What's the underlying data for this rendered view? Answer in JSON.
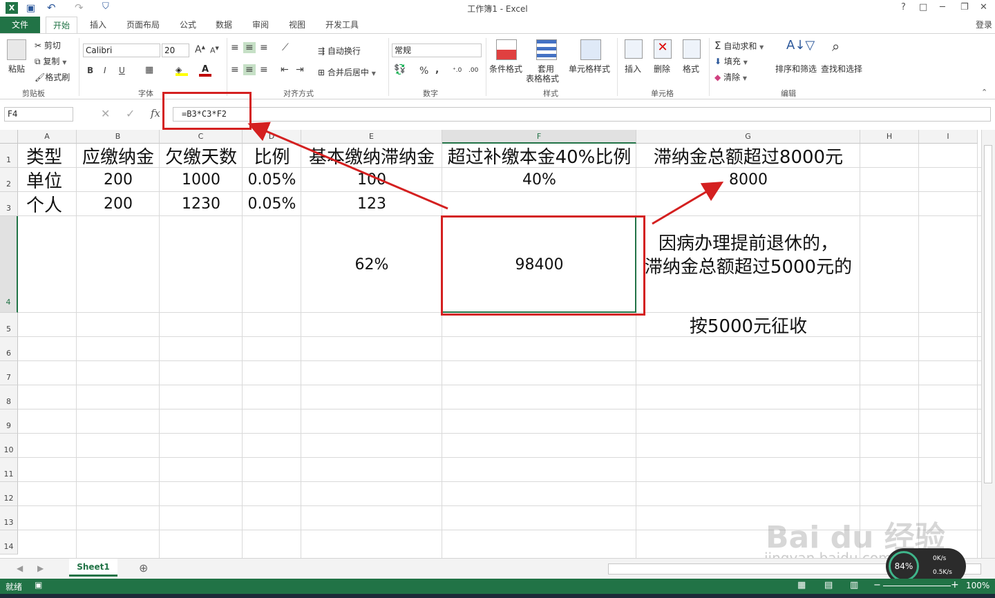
{
  "window": {
    "title": "工作簿1 - Excel",
    "controls": [
      "?",
      "□",
      "─",
      "❐",
      "✕"
    ],
    "signin": "登录"
  },
  "ribbon_tabs": [
    "文件",
    "开始",
    "插入",
    "页面布局",
    "公式",
    "数据",
    "审阅",
    "视图",
    "开发工具"
  ],
  "clipboard": {
    "paste": "粘贴",
    "cut": "剪切",
    "copy": "复制",
    "format_painter": "格式刷",
    "group": "剪贴板"
  },
  "font": {
    "name": "Calibri",
    "size": "20",
    "group": "字体",
    "bold": "B",
    "italic": "I",
    "underline": "U"
  },
  "alignment": {
    "wrap": "自动换行",
    "merge": "合并后居中",
    "group": "对齐方式"
  },
  "number": {
    "format": "常规",
    "percent": "%",
    "comma": ",",
    "group": "数字"
  },
  "styles": {
    "conditional": "条件格式",
    "table1": "套用",
    "table2": "表格格式",
    "cell_styles": "单元格样式",
    "group": "样式"
  },
  "cells": {
    "insert": "插入",
    "delete": "删除",
    "format": "格式",
    "group": "单元格"
  },
  "editing": {
    "autosum": "自动求和",
    "fill": "填充",
    "clear": "清除",
    "sort": "排序和筛选",
    "find": "查找和选择",
    "group": "编辑"
  },
  "formula_bar": {
    "name_box": "F4",
    "formula": "=B3*C3*F2",
    "fx": "fx"
  },
  "columns": [
    "A",
    "B",
    "C",
    "D",
    "E",
    "F",
    "G",
    "H",
    "I"
  ],
  "rows": [
    "1",
    "2",
    "3",
    "4",
    "5",
    "6",
    "7",
    "8",
    "9",
    "10",
    "11",
    "12",
    "13",
    "14"
  ],
  "cells_data": {
    "A1": "类型",
    "B1": "应缴纳金",
    "C1": "欠缴天数",
    "D1": "比例",
    "E1": "基本缴纳滞纳金",
    "F1": "超过补缴本金40%比例",
    "G1": "滞纳金总额超过8000元",
    "A2": "单位",
    "B2": "200",
    "C2": "1000",
    "D2": "0.05%",
    "E2": "100",
    "F2": "40%",
    "G2": "8000",
    "A3": "个人",
    "B3": "200",
    "C3": "1230",
    "D3": "0.05%",
    "E3": "123",
    "E4": "62%",
    "F4": "98400",
    "G4a": "因病办理提前退休的，",
    "G4b": "滞纳金总额超过5000元的",
    "G5": "按5000元征收"
  },
  "sheet": {
    "tab": "Sheet1",
    "add": "⊕"
  },
  "status": {
    "ready": "就绪",
    "zoom": "100%"
  },
  "watermark": {
    "text1": "Bai du 经验",
    "text2": "jingyan.baidu.com"
  },
  "netmeter": {
    "pct": "84%",
    "up": "0K/s",
    "down": "0.5K/s"
  },
  "colors": {
    "excel_green": "#217346",
    "annotation_red": "#d42020"
  }
}
